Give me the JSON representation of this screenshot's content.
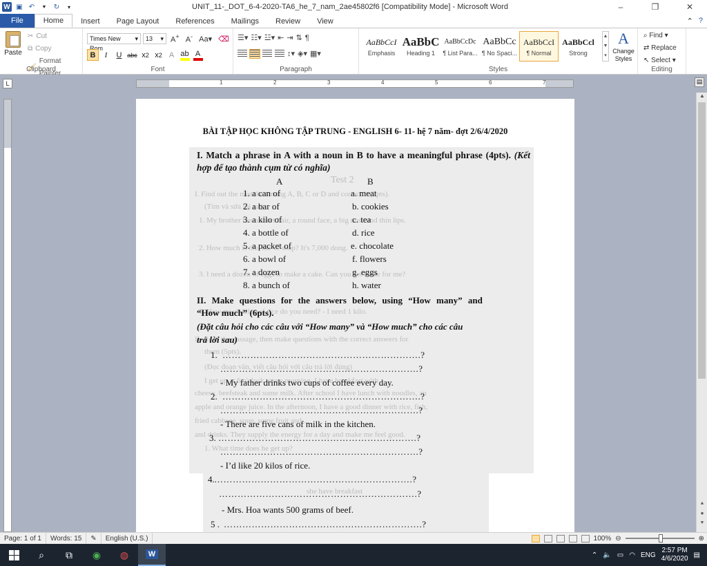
{
  "window": {
    "title": "UNIT_11-_DOT_6-4-2020-TA6_he_7_nam_2ae45802f6 [Compatibility Mode] - Microsoft Word",
    "app_icon": "W",
    "controls": [
      "–",
      "❐",
      "✕"
    ]
  },
  "tabs": [
    "File",
    "Home",
    "Insert",
    "Page Layout",
    "References",
    "Mailings",
    "Review",
    "View"
  ],
  "active_tab": "Home",
  "ribbon": {
    "clipboard": {
      "label": "Clipboard",
      "paste": "Paste",
      "cut": "Cut",
      "copy": "Copy",
      "format_painter": "Format Painter"
    },
    "font": {
      "label": "Font",
      "font_name": "Times New Rom",
      "font_size": "13"
    },
    "paragraph": {
      "label": "Paragraph"
    },
    "styles": {
      "label": "Styles",
      "items": [
        {
          "preview": "AaBbCcI",
          "name": "Emphasis"
        },
        {
          "preview": "AaBbC",
          "name": "Heading 1"
        },
        {
          "preview": "AaBbCcDc",
          "name": "¶ List Para..."
        },
        {
          "preview": "AaBbCc",
          "name": "¶ No Spaci..."
        },
        {
          "preview": "AaBbCcI",
          "name": "¶ Normal"
        },
        {
          "preview": "AaBbCcl",
          "name": "Strong"
        }
      ],
      "change_styles": "Change Styles"
    },
    "editing": {
      "label": "Editing",
      "find": "Find",
      "replace": "Replace",
      "select": "Select"
    }
  },
  "ruler": {
    "numbers": [
      "1",
      "2",
      "3",
      "4",
      "5",
      "6",
      "7"
    ]
  },
  "document": {
    "heading": "BÀI TẬP HỌC KHÔNG TẬP TRUNG - ENGLISH 6- 11- hệ 7 năm- đợt 2/6/4/2020",
    "section1": {
      "title": "I. Match a phrase in A with a noun in B to have a meaningful phrase (4pts).",
      "title_vi": "(Kết hợp để tạo thành cụm từ có nghĩa)",
      "col_a": "A",
      "col_b": "B",
      "a_items": [
        "1. a can of",
        "2. a bar of",
        "3. a kilo of",
        "4. a bottle of",
        "5. a packet of",
        "6. a bowl of",
        "7. a dozen",
        "8. a bunch of"
      ],
      "b_items": [
        "a. meat",
        "b. cookies",
        "c. tea",
        "d. rice",
        "e. chocolate",
        "f. flowers",
        "g. eggs",
        "h. water"
      ]
    },
    "section2": {
      "title_line1": "II. Make questions for the answers below, using “How many” and",
      "title_line2": "“How much” (6pts).",
      "vi_line1": "(Đặt câu hỏi cho các câu với “How many” và “How much” cho các câu",
      "vi_line2": "trả lời sau)",
      "items": [
        {
          "num": "1.",
          "answer": "- My father drinks two cups of coffee every day."
        },
        {
          "num": "2.",
          "answer": "- There are five cans of milk in the kitchen."
        },
        {
          "num": "3.",
          "answer": "- I’d like 20 kilos of rice."
        },
        {
          "num": "4.",
          "answer": "- Mrs. Hoa wants 500 grams of beef."
        },
        {
          "num": "5 .",
          "answer": ""
        }
      ],
      "dots_line": "……………………………………………………….?"
    },
    "ghost_text": [
      "Test 2",
      "I. Find out the mistake among A, B, C or D and correct it (2pts).",
      "(Tìm và sửa lỗi sai)",
      "1. My brother has a short hair, a round face, a big nose and thin lips.",
      "2. How much is this bar of soap? It's 7,000 dong.",
      "3. I need a dozen of eggs to make a cake. Can you get some for me?",
      "5. How much kilos of rice do you need? - I need 1 kilo.",
      "II. Read the passage, then make questions with the correct answers for",
      "them (5pts).",
      "(Đọc đoạn văn, viết câu hỏi với câu trả lời đúng)",
      "I get up at 6 o'clock every morning. I have breakfast with",
      "cheese, beefsteak and some milk. After school I have lunch with noodles, an",
      "apple and orange juice. In the afternoon, I have a good dinner with rice, fish,",
      "fried cabbage, soup, some fruit and ... ",
      "and drinks. They supply the energy for a day and make me feel good.",
      "1. What time does he get up?",
      "she have breakfast"
    ]
  },
  "status": {
    "page": "Page: 1 of 1",
    "words": "Words: 15",
    "language": "English (U.S.)",
    "zoom": "100%"
  },
  "taskbar": {
    "lang": "ENG",
    "time": "2:57 PM",
    "date": "4/6/2020"
  }
}
